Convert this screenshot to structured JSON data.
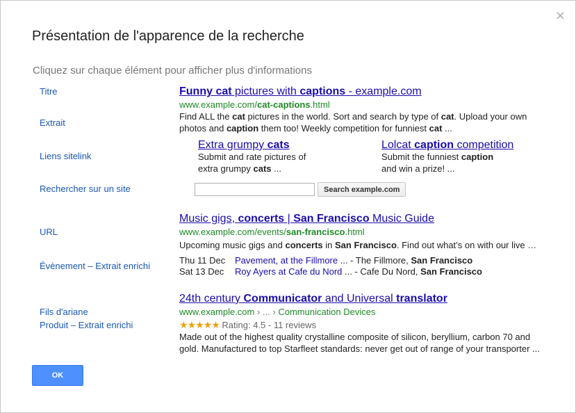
{
  "dialog": {
    "close": "×",
    "title": "Présentation de l'apparence de la recherche",
    "subtitle": "Cliquez sur chaque élément pour afficher plus d'informations",
    "ok": "OK"
  },
  "labels": {
    "titre": "Titre",
    "extrait": "Extrait",
    "sitelinks": "Liens sitelink",
    "search_site": "Rechercher sur un site",
    "url": "URL",
    "event": "Évènement – Extrait enrichi",
    "breadcrumbs": "Fils d'ariane",
    "product": "Produit – Extrait enrichi"
  },
  "result1": {
    "title_a": "Funny cat",
    "title_b": " pictures with ",
    "title_c": "captions",
    "title_d": " - example.com",
    "url_a": "www.example.com/",
    "url_b": "cat-captions",
    "url_c": ".html",
    "snip1_a": "Find ALL the ",
    "snip1_b": "cat",
    "snip1_c": " pictures in the world. Sort and search by type of ",
    "snip1_d": "cat",
    "snip1_e": ". Upload your own",
    "snip2_a": "photos and ",
    "snip2_b": "caption",
    "snip2_c": " them too! Weekly competition for funniest ",
    "snip2_d": "cat",
    "snip2_e": " ..."
  },
  "sitelinks": [
    {
      "title_a": "Extra grumpy ",
      "title_b": "cats",
      "line1": "Submit and rate pictures of",
      "line2_a": "extra grumpy ",
      "line2_b": "cats",
      "line2_c": " ..."
    },
    {
      "title_a": "Lolcat ",
      "title_b": "caption",
      "title_c": " competition",
      "line1_a": "Submit the funniest ",
      "line1_b": "caption",
      "line2": "and win a prize! ..."
    }
  ],
  "site_search": {
    "placeholder": "",
    "button": "Search example.com"
  },
  "result2": {
    "title_a": "Music gigs, ",
    "title_b": "concerts",
    "title_c": " | ",
    "title_d": "San Francisco",
    "title_e": " Music Guide",
    "url_a": "www.example.com/events/",
    "url_b": "san-francisco",
    "url_c": ".html",
    "snip_a": "Upcoming music gigs and ",
    "snip_b": "concerts",
    "snip_c": " in ",
    "snip_d": "San Francisco",
    "snip_e": ". Find out what’s on with our live …",
    "events": [
      {
        "date": "Thu 11 Dec",
        "link": "Pavement, at the Fillmore",
        "rest": " ... - The Fillmore, ",
        "place": "San Francisco"
      },
      {
        "date": "Sat 13 Dec",
        "link": "Roy Ayers at Cafe du Nord",
        "rest": " ... - Cafe Du Nord, ",
        "place": "San Francisco"
      }
    ]
  },
  "result3": {
    "title_a": "24th century ",
    "title_b": "Communicator",
    "title_c": " and Universal ",
    "title_d": "translator",
    "url_a": "www.example.com",
    "url_b": " › ... › ",
    "url_c": "Communication Devices",
    "stars": "★★★★★",
    "rating": "Rating: 4.5 - 11 reviews",
    "snip1": "Made out of the highest quality crystalline composite of silicon, beryllium, carbon 70 and",
    "snip2": "gold. Manufactured to top Starfleet standards: never get out of range of your transporter ..."
  },
  "colors": {
    "link": "#1a0dab",
    "url": "#1e8a27",
    "label": "#1a57b4",
    "ok_button": "#4d90fe",
    "stars": "#e7a20e"
  }
}
